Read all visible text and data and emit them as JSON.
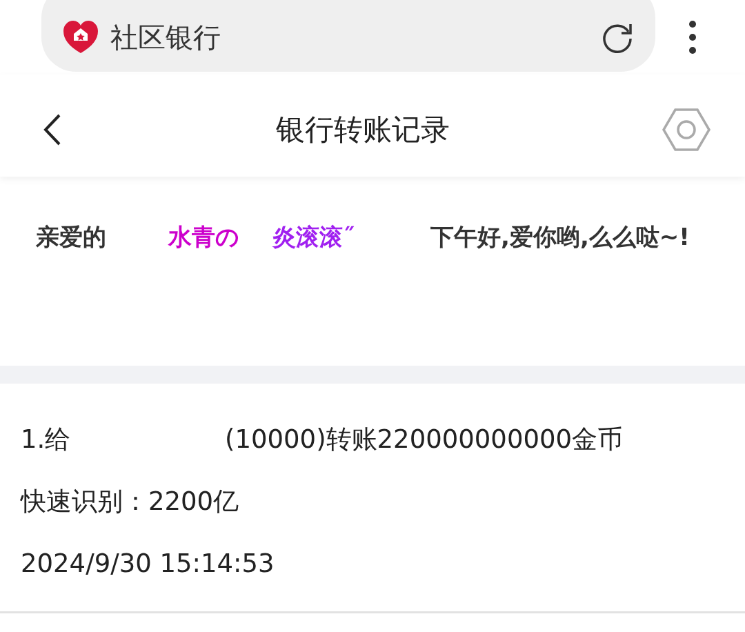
{
  "address_bar": {
    "site_name": "社区银行"
  },
  "header": {
    "title": "银行转账记录"
  },
  "greeting": [
    {
      "text": "亲爱的",
      "color": "#333333"
    },
    {
      "text": "水青の",
      "color": "#cc00cc"
    },
    {
      "text": "炎滚滚˝",
      "color": "#a020f0"
    },
    {
      "text": "下午好,爱你哟,",
      "color": "#333333"
    },
    {
      "text": "么么哒~!",
      "color": "#333333"
    }
  ],
  "record": {
    "recipient_prefix": "1.给",
    "transfer": "(10000)转账220000000000金币",
    "quick_read": "快速识别：2200亿",
    "time": "2024/9/30 15:14:53"
  }
}
